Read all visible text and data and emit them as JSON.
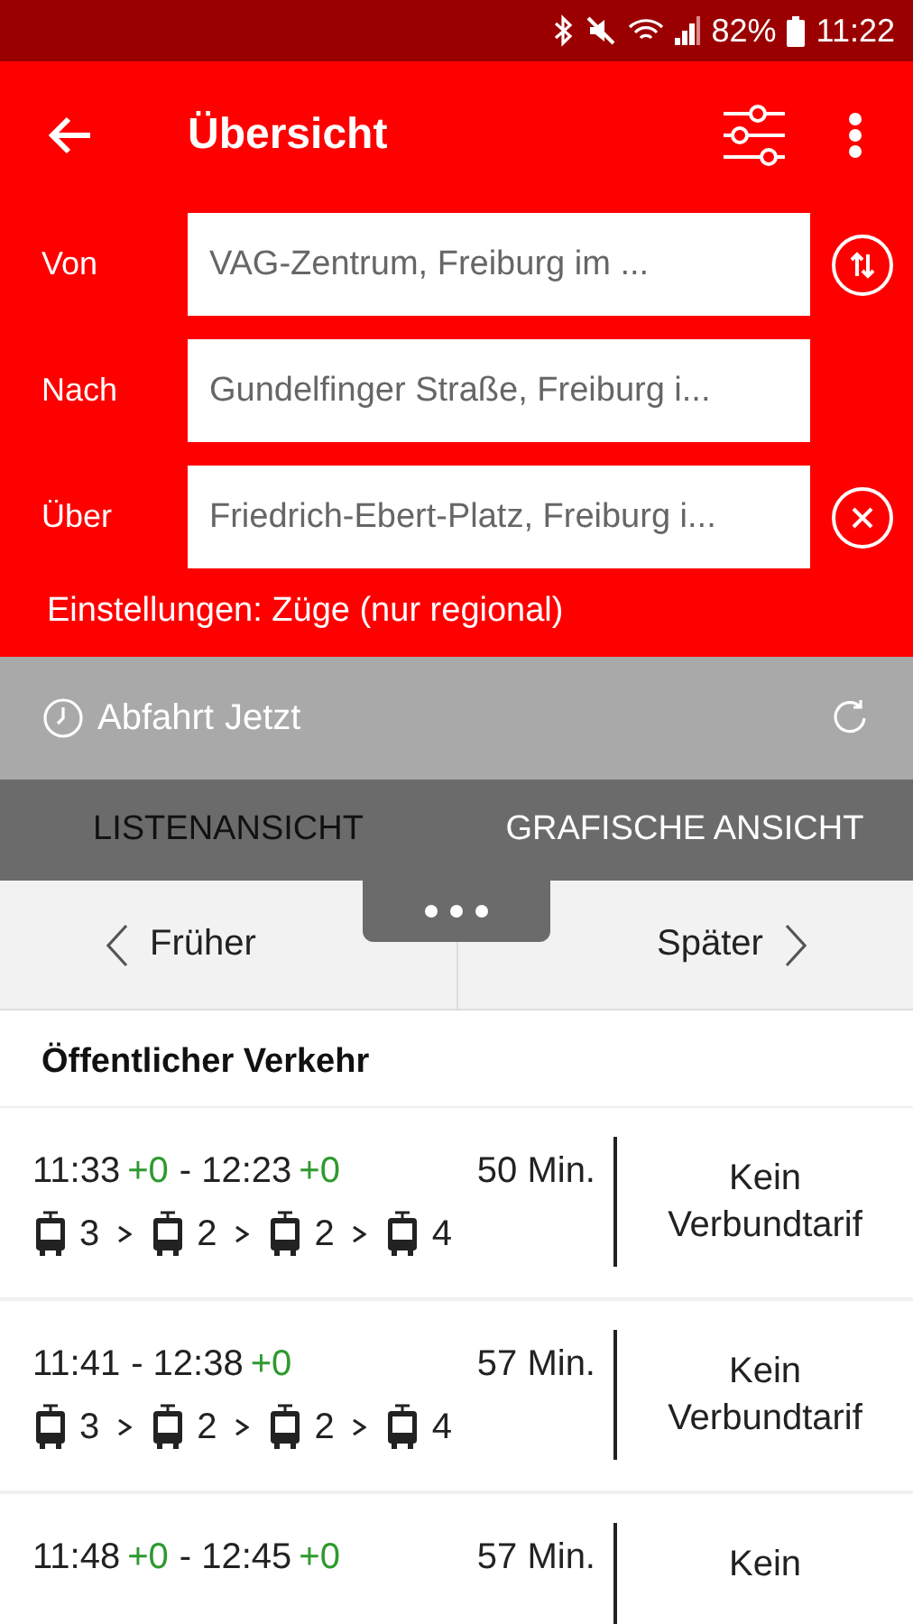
{
  "status_bar": {
    "battery": "82%",
    "time": "11:22"
  },
  "toolbar": {
    "title": "Übersicht"
  },
  "route": {
    "fields": [
      {
        "label": "Von",
        "value": "VAG-Zentrum, Freiburg im ...",
        "kind": "swap"
      },
      {
        "label": "Nach",
        "value": "Gundelfinger Straße, Freiburg i..."
      },
      {
        "label": "Über",
        "value": "Friedrich-Ebert-Platz, Freiburg i...",
        "kind": "clear"
      }
    ],
    "settings": "Einstellungen: Züge (nur regional)"
  },
  "time_bar": {
    "label": "Abfahrt",
    "value": "Jetzt"
  },
  "tabs": [
    {
      "label": "LISTENANSICHT",
      "selected": true
    },
    {
      "label": "GRAFISCHE ANSICHT",
      "selected": false
    }
  ],
  "paging": {
    "earlier": "Früher",
    "later": "Später"
  },
  "section": "Öffentlicher Verkehr",
  "connections": [
    {
      "departure": "11:33",
      "departure_delay": "+0",
      "arrival": "- 12:23",
      "arrival_delay": "+0",
      "duration": "50 Min.",
      "legs": [
        {
          "line": "3"
        },
        {
          "line": "2"
        },
        {
          "line": "2"
        },
        {
          "line": "4"
        }
      ],
      "fare": "Kein Verbundtarif"
    },
    {
      "departure": "11:41",
      "arrival": "- 12:38",
      "arrival_delay": "+0",
      "duration": "57 Min.",
      "legs": [
        {
          "line": "3"
        },
        {
          "line": "2"
        },
        {
          "line": "2"
        },
        {
          "line": "4"
        }
      ],
      "fare": "Kein Verbundtarif"
    },
    {
      "departure": "11:48",
      "departure_delay": "+0",
      "arrival": "- 12:45",
      "arrival_delay": "+0",
      "duration": "57 Min.",
      "fare": "Kein"
    }
  ]
}
